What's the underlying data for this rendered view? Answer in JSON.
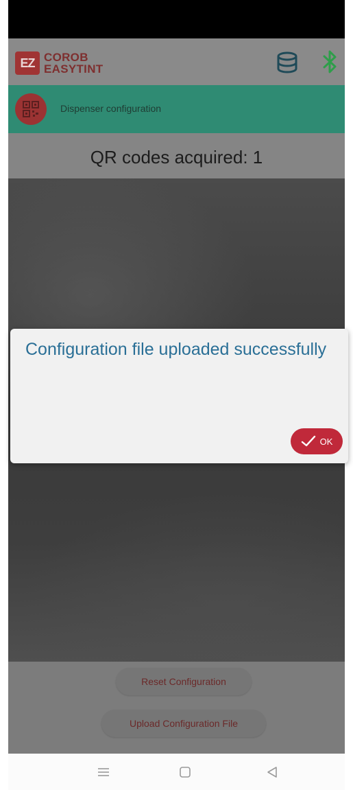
{
  "app": {
    "logo_mark": "EZ",
    "logo_line1": "COROB",
    "logo_line2": "EASYTINT",
    "icons": [
      "database-icon",
      "bluetooth-icon"
    ]
  },
  "screen": {
    "title": "Dispenser configuration",
    "qr_count_label": "QR codes acquired: 1"
  },
  "dialog": {
    "message": "Configuration file uploaded successfully",
    "ok_label": "OK"
  },
  "actions": {
    "reset_label": "Reset Configuration",
    "upload_label": "Upload Configuration File"
  },
  "nav": {
    "icons": [
      "menu-icon",
      "home-icon",
      "back-icon"
    ]
  },
  "colors": {
    "header_bar": "#2f8b73",
    "accent_red": "#c0293a",
    "dialog_text": "#2a6f96",
    "bluetooth_green": "#2e9e4a"
  }
}
